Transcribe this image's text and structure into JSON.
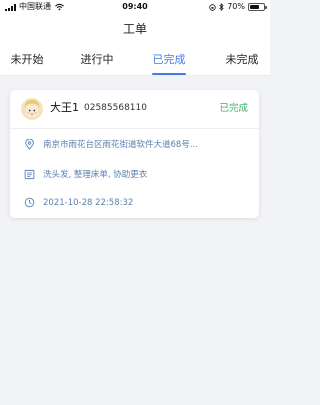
{
  "status_bar": {
    "carrier": "中国联通",
    "time": "09:40",
    "battery": "70%",
    "battery_level": 0.7
  },
  "nav": {
    "title": "工单"
  },
  "tabs": [
    {
      "label": "未开始",
      "active": false
    },
    {
      "label": "进行中",
      "active": false
    },
    {
      "label": "已完成",
      "active": true
    },
    {
      "label": "未完成",
      "active": false
    }
  ],
  "order": {
    "name": "大王1",
    "phone": "02585568110",
    "status": "已完成",
    "address": "南京市雨花台区雨花街道软件大道68号...",
    "services": "洗头发, 整理床单, 协助更衣",
    "datetime": "2021-10-28 22:58:32"
  },
  "colors": {
    "accent": "#4a7ce0",
    "status_done": "#3fae6e",
    "detail_text": "#5b80b0",
    "background": "#f2f3f7"
  },
  "icons": {
    "location": "location-pin-icon",
    "services": "list-icon",
    "time": "clock-icon"
  }
}
